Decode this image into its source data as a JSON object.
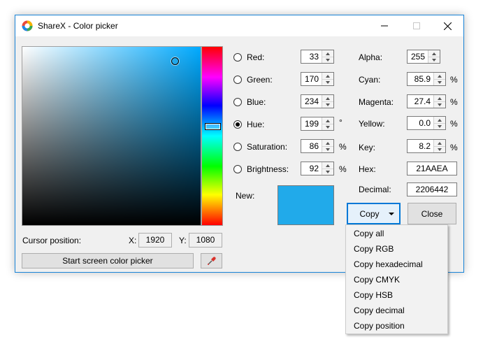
{
  "window": {
    "title": "ShareX - Color picker",
    "icon": "sharex-logo-icon",
    "controls": [
      "minimize-icon",
      "maximize-icon",
      "close-icon"
    ]
  },
  "picker": {
    "current_color": "#21AAEA",
    "hue_degrees": 199
  },
  "fields": {
    "red": {
      "label": "Red:",
      "value": "33"
    },
    "green": {
      "label": "Green:",
      "value": "170"
    },
    "blue": {
      "label": "Blue:",
      "value": "234"
    },
    "hue": {
      "label": "Hue:",
      "value": "199",
      "unit": "°"
    },
    "saturation": {
      "label": "Saturation:",
      "value": "86",
      "unit": "%"
    },
    "brightness": {
      "label": "Brightness:",
      "value": "92",
      "unit": "%"
    },
    "alpha": {
      "label": "Alpha:",
      "value": "255"
    },
    "cyan": {
      "label": "Cyan:",
      "value": "85.9",
      "unit": "%"
    },
    "magenta": {
      "label": "Magenta:",
      "value": "27.4",
      "unit": "%"
    },
    "yellow": {
      "label": "Yellow:",
      "value": "0.0",
      "unit": "%"
    },
    "key": {
      "label": "Key:",
      "value": "8.2",
      "unit": "%"
    },
    "hex": {
      "label": "Hex:",
      "value": "21AAEA"
    },
    "decimal": {
      "label": "Decimal:",
      "value": "2206442"
    }
  },
  "selected_mode": "hue",
  "new_label": "New:",
  "cursor": {
    "label": "Cursor position:",
    "x_label": "X:",
    "x_value": "1920",
    "y_label": "Y:",
    "y_value": "1080"
  },
  "buttons": {
    "copy": "Copy",
    "close": "Close",
    "start_picker": "Start screen color picker",
    "eyedropper_icon": "eyedropper-icon"
  },
  "copy_menu": {
    "items": [
      "Copy all",
      "Copy RGB",
      "Copy hexadecimal",
      "Copy CMYK",
      "Copy HSB",
      "Copy decimal",
      "Copy position"
    ]
  },
  "colors": {
    "accent": "#0078d7",
    "window_border": "#1883d7",
    "background": "#f0f0f0"
  }
}
